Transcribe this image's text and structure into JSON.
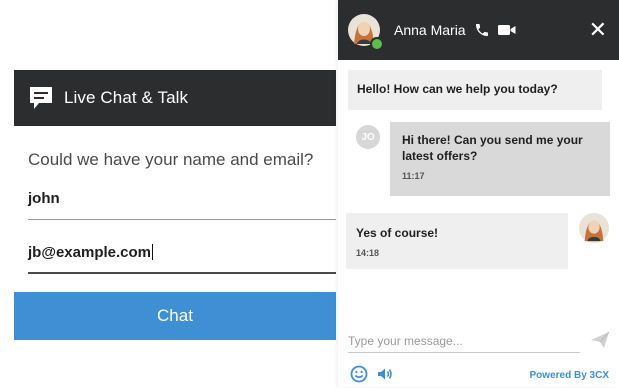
{
  "form": {
    "title": "Live Chat & Talk",
    "question": "Could we have your name and email?",
    "name_value": "john",
    "email_value": "jb@example.com",
    "chat_button": "Chat"
  },
  "chat": {
    "agent_name": "Anna Maria",
    "close_label": "✕",
    "messages": [
      {
        "sender": "agent",
        "text": "Hello! How can we help you today?"
      },
      {
        "sender": "visitor",
        "initials": "JO",
        "text": "Hi there! Can you send me your latest offers?",
        "time": "11:17"
      },
      {
        "sender": "agent",
        "text": "Yes of course!",
        "time": "14:18"
      }
    ],
    "input_placeholder": "Type your message...",
    "powered_by": "Powered By 3CX"
  },
  "icons": {
    "chat": "chat-bubble-icon",
    "phone": "phone-icon",
    "video": "video-icon",
    "send": "send-icon",
    "emoji": "emoji-icon",
    "sound": "speaker-icon"
  },
  "colors": {
    "header_bg": "#2b2d2f",
    "button_blue": "#3f8fd4",
    "bubble_gray": "#efefef",
    "online_green": "#5bbd4c"
  }
}
